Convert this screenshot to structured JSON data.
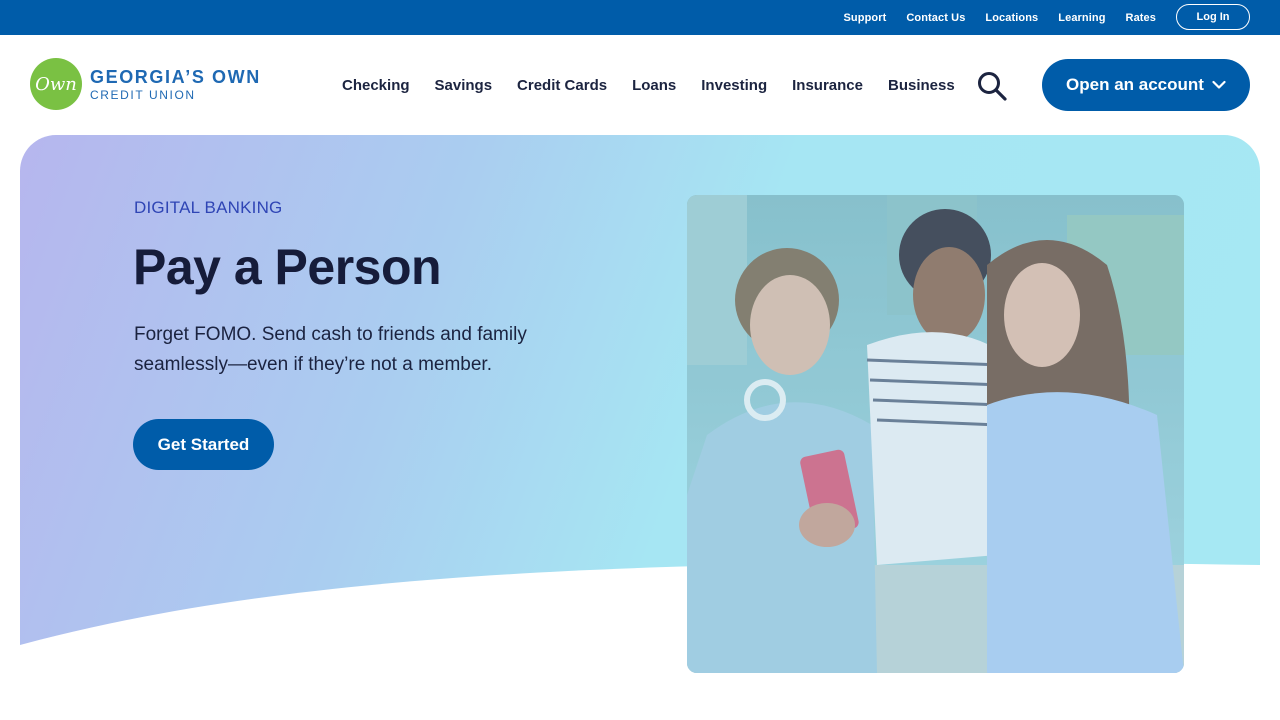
{
  "utility": {
    "links": [
      "Support",
      "Contact Us",
      "Locations",
      "Learning",
      "Rates"
    ],
    "login_label": "Log In"
  },
  "logo": {
    "mark_text": "Own",
    "line1": "GEORGIA’S OWN",
    "line2": "CREDIT UNION"
  },
  "nav": {
    "items": [
      "Checking",
      "Savings",
      "Credit Cards",
      "Loans",
      "Investing",
      "Insurance",
      "Business"
    ],
    "open_account_label": "Open an account"
  },
  "hero": {
    "eyebrow": "DIGITAL BANKING",
    "title": "Pay a Person",
    "subtitle": "Forget FOMO. Send cash to friends and family seamlessly—even if they’re not a member.",
    "cta_label": "Get Started"
  },
  "colors": {
    "brand_blue": "#005ca9",
    "logo_green": "#7ac143",
    "heading_navy": "#161c3a",
    "eyebrow_blue": "#2f45b5"
  },
  "icons": {
    "search": "search-icon",
    "chevron": "chevron-down-icon"
  }
}
